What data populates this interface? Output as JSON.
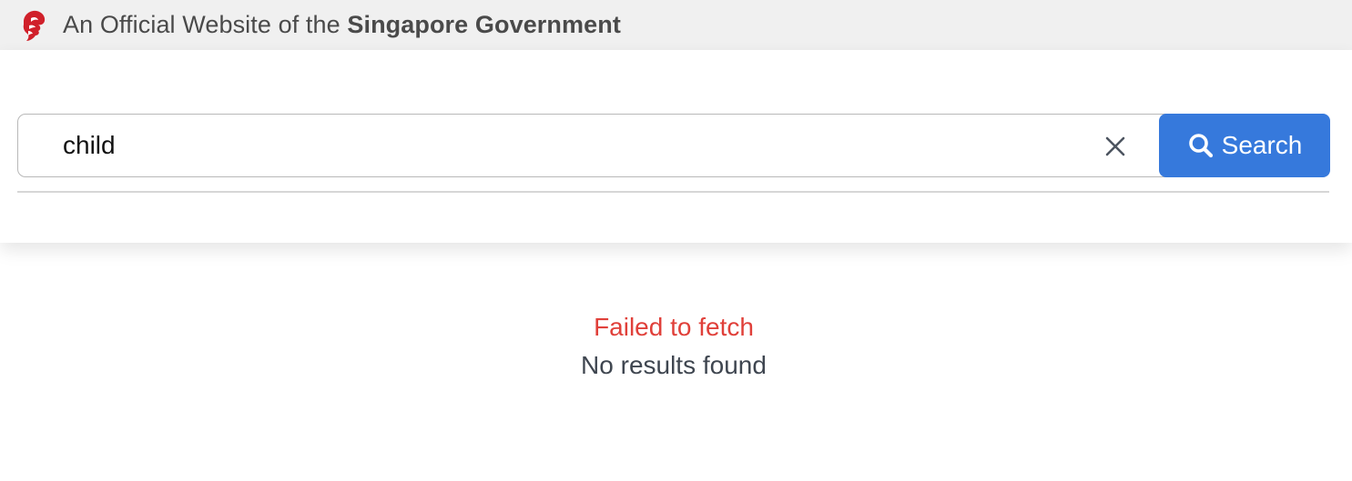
{
  "masthead": {
    "prefix": "An Official Website of the ",
    "emphasis": "Singapore Government",
    "icon": "lion-head-icon",
    "icon_color": "#d0202a"
  },
  "search": {
    "value": "child",
    "clear_icon": "close-icon",
    "button_label": "Search",
    "button_icon": "search-icon",
    "button_color": "#3679dc"
  },
  "results": {
    "error": "Failed to fetch",
    "error_color": "#e0403a",
    "empty": "No results found"
  }
}
